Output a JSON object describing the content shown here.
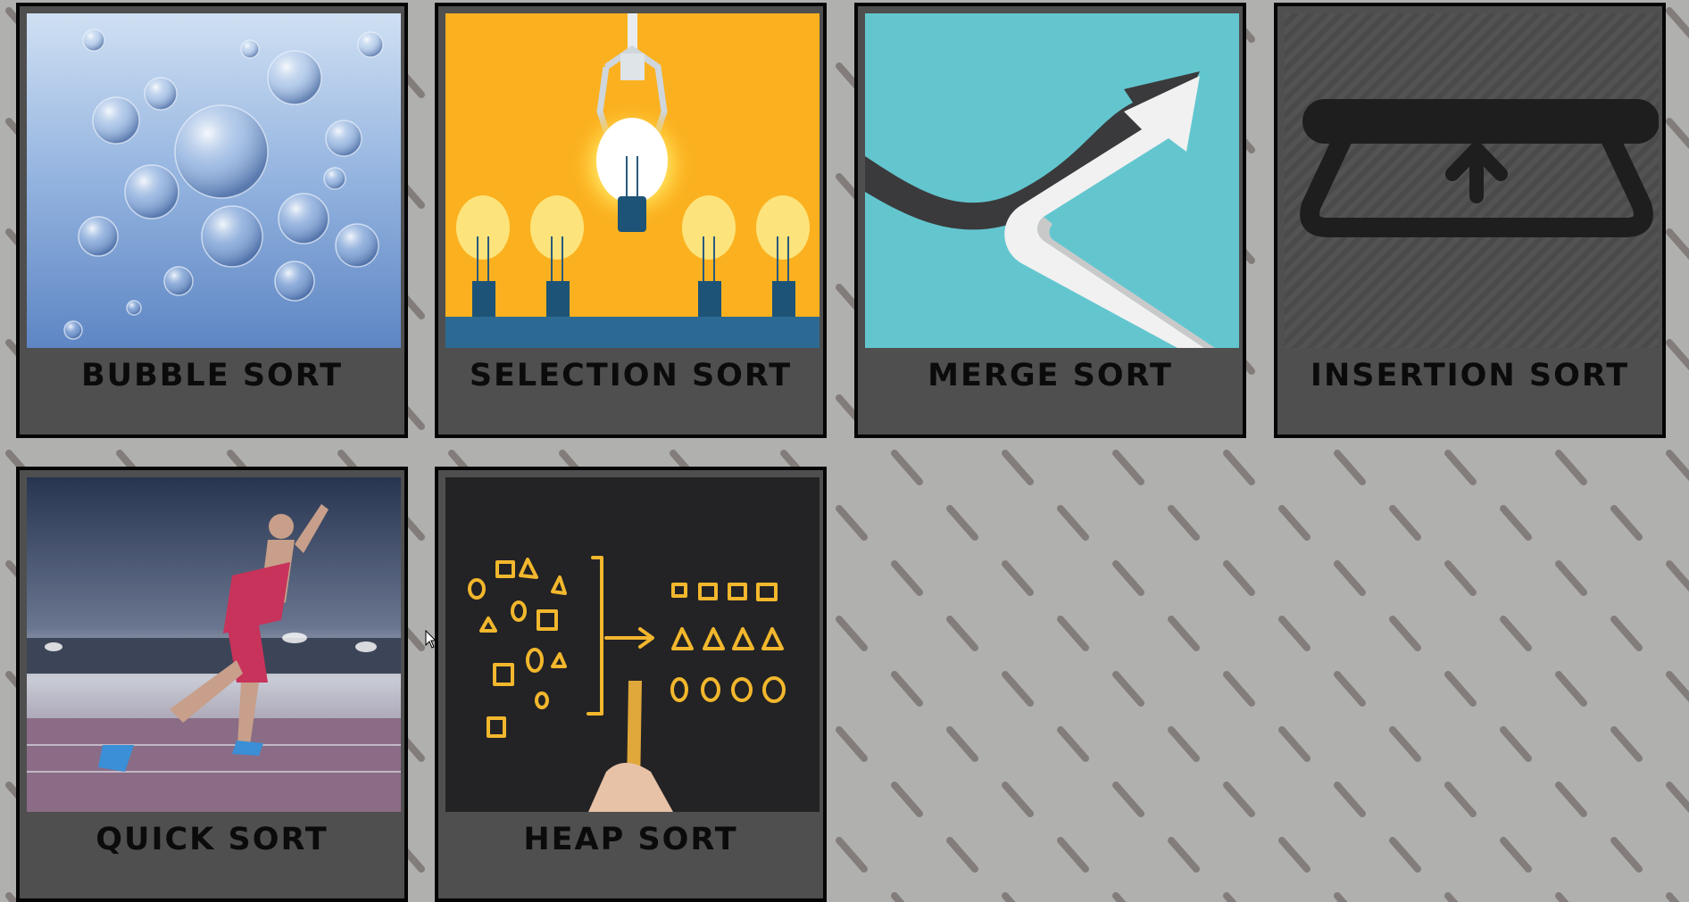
{
  "cards": [
    {
      "label": "BUBBLE SORT",
      "image": "bubbles-image"
    },
    {
      "label": "SELECTION SORT",
      "image": "light-bulbs-claw-image"
    },
    {
      "label": "MERGE SORT",
      "image": "merging-arrows-image"
    },
    {
      "label": "INSERTION SORT",
      "image": "insert-slot-icon"
    },
    {
      "label": "QUICK SORT",
      "image": "sprinter-image"
    },
    {
      "label": "HEAP SORT",
      "image": "chalk-shapes-image"
    }
  ],
  "colors": {
    "card_bg": "#4f4f4f",
    "card_border": "#050505",
    "page_bg": "#b0b0ae",
    "label_text": "#0b0b0b"
  }
}
